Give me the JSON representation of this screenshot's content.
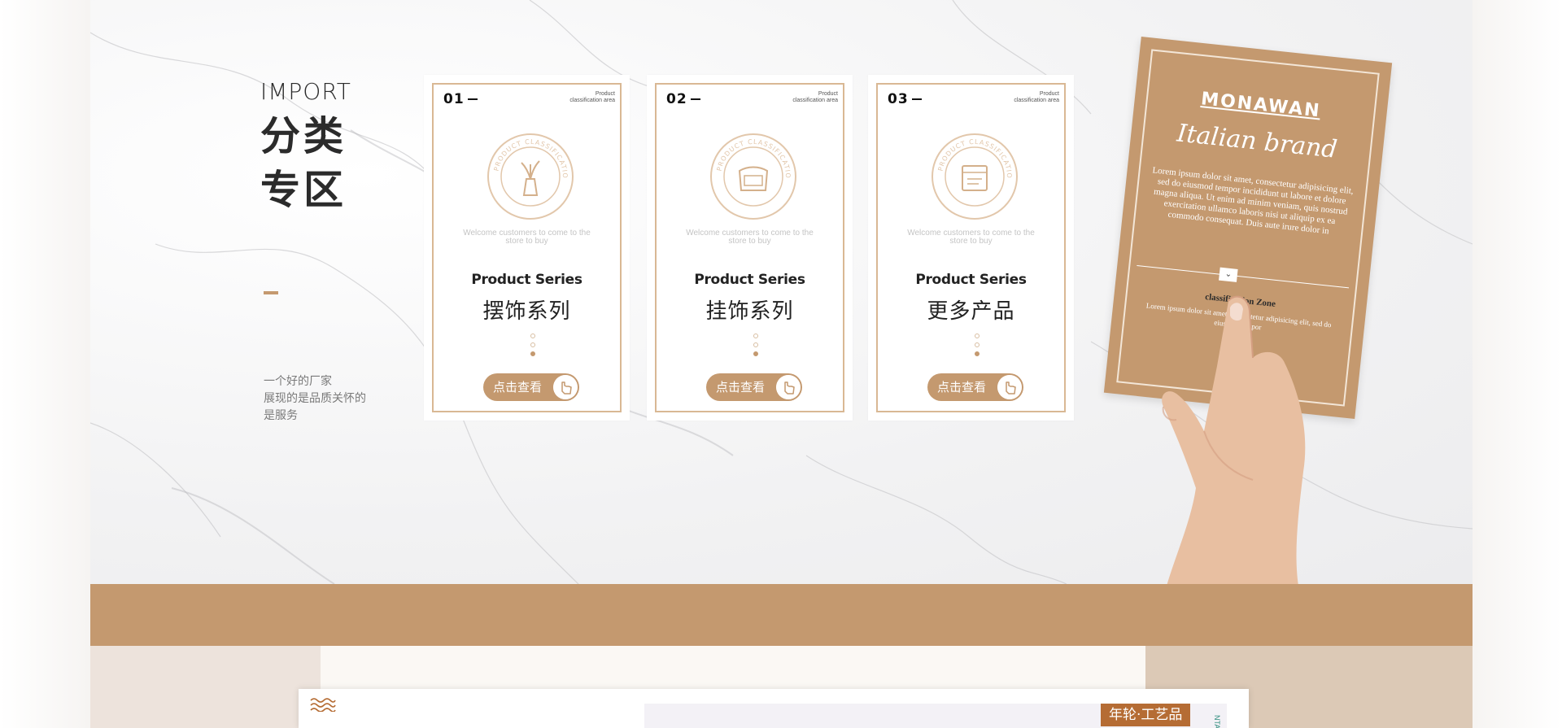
{
  "intro": {
    "en_title": "IMPORT",
    "cn_title_line1": "分类",
    "cn_title_line2": "专区",
    "desc_line1": "一个好的厂家",
    "desc_line2": "展现的是品质关怀的",
    "desc_line3": "是服务"
  },
  "cards": [
    {
      "num": "01",
      "tag": "Product classification area",
      "emblem_text": "PRODUCT CLASSIFICATION",
      "icon": "vase-icon",
      "welcome": "Welcome customers to come to the store to buy",
      "series": "Product Series",
      "title": "摆饰系列",
      "button": "点击查看"
    },
    {
      "num": "02",
      "tag": "Product classification area",
      "emblem_text": "PRODUCT CLASSIFICATION",
      "icon": "ornament-icon",
      "welcome": "Welcome customers to come to the store to buy",
      "series": "Product Series",
      "title": "挂饰系列",
      "button": "点击查看"
    },
    {
      "num": "03",
      "tag": "Product classification area",
      "emblem_text": "PRODUCT CLASSIFICATION",
      "icon": "box-icon",
      "welcome": "Welcome customers to come to the store to buy",
      "series": "Product Series",
      "title": "更多产品",
      "button": "点击查看"
    }
  ],
  "brand_card": {
    "logo": "MONAWAN",
    "script": "Italian brand",
    "lorem": "Lorem ipsum dolor sit amet, consectetur adipisicing elit, sed do eiusmod tempor incididunt ut labore et dolore magna aliqua. Ut enim ad minim veniam, quis nostrud exercitation ullamco laboris nisi ut aliquip ex ea commodo consequat. Duis aute irure dolor in",
    "zone": "classification Zone",
    "zone_sub": "Lorem ipsum dolor sit amet, consectetur adipisicing elit, sed do eiusmod tempor"
  },
  "bottom": {
    "tag": "年轮·工艺品",
    "vertical_text": "NTA"
  },
  "colors": {
    "accent": "#c4996f",
    "tag_brown": "#b56c34",
    "text_dark": "#2b2b2b"
  }
}
